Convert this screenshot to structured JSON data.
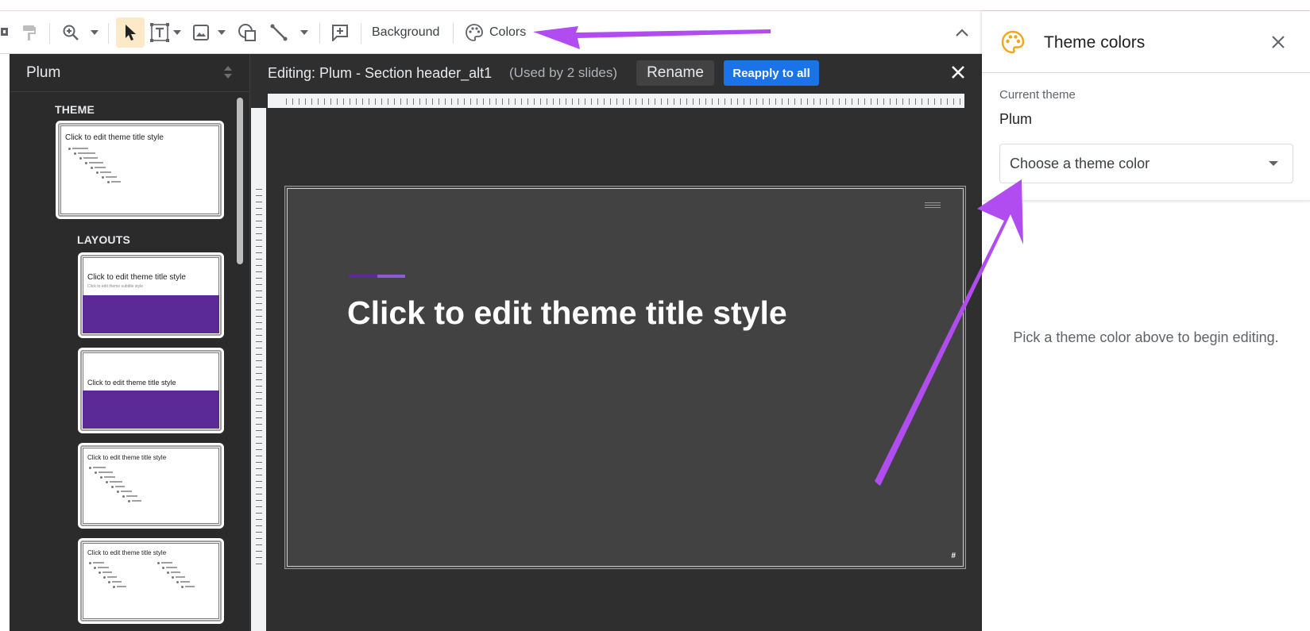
{
  "toolbar": {
    "background_label": "Background",
    "colors_label": "Colors",
    "icons": [
      "paint-format-icon",
      "zoom-icon",
      "select-cursor-icon",
      "text-box-icon",
      "image-icon",
      "shape-icon",
      "line-icon",
      "comment-icon",
      "palette-icon",
      "collapse-chevron-icon"
    ]
  },
  "left_panel": {
    "theme_name": "Plum",
    "theme_section_label": "THEME",
    "layouts_section_label": "LAYOUTS",
    "thumbnails": [
      {
        "title": "Click to edit theme title style"
      },
      {
        "title": "Click to edit theme title style",
        "subtitle": "Click to edit theme subtitle style"
      },
      {
        "title": "Click to edit theme title style"
      },
      {
        "title": "Click to edit theme title style"
      },
      {
        "title": "Click to edit theme title style"
      }
    ]
  },
  "editor": {
    "editing_title": "Editing: Plum - Section header_alt1",
    "used_by": "(Used by 2 slides)",
    "rename_label": "Rename",
    "reapply_label": "Reapply to all"
  },
  "slide": {
    "title": "Click to edit theme title style",
    "number": "#",
    "accent_color": "#5b2a97",
    "accent_light_color": "#8d5cd4"
  },
  "right_panel": {
    "title": "Theme colors",
    "current_theme_label": "Current theme",
    "current_theme_value": "Plum",
    "select_placeholder": "Choose a theme color",
    "hint": "Pick a theme color above to begin editing."
  },
  "annotation": {
    "arrow_color": "#b14cf0"
  }
}
